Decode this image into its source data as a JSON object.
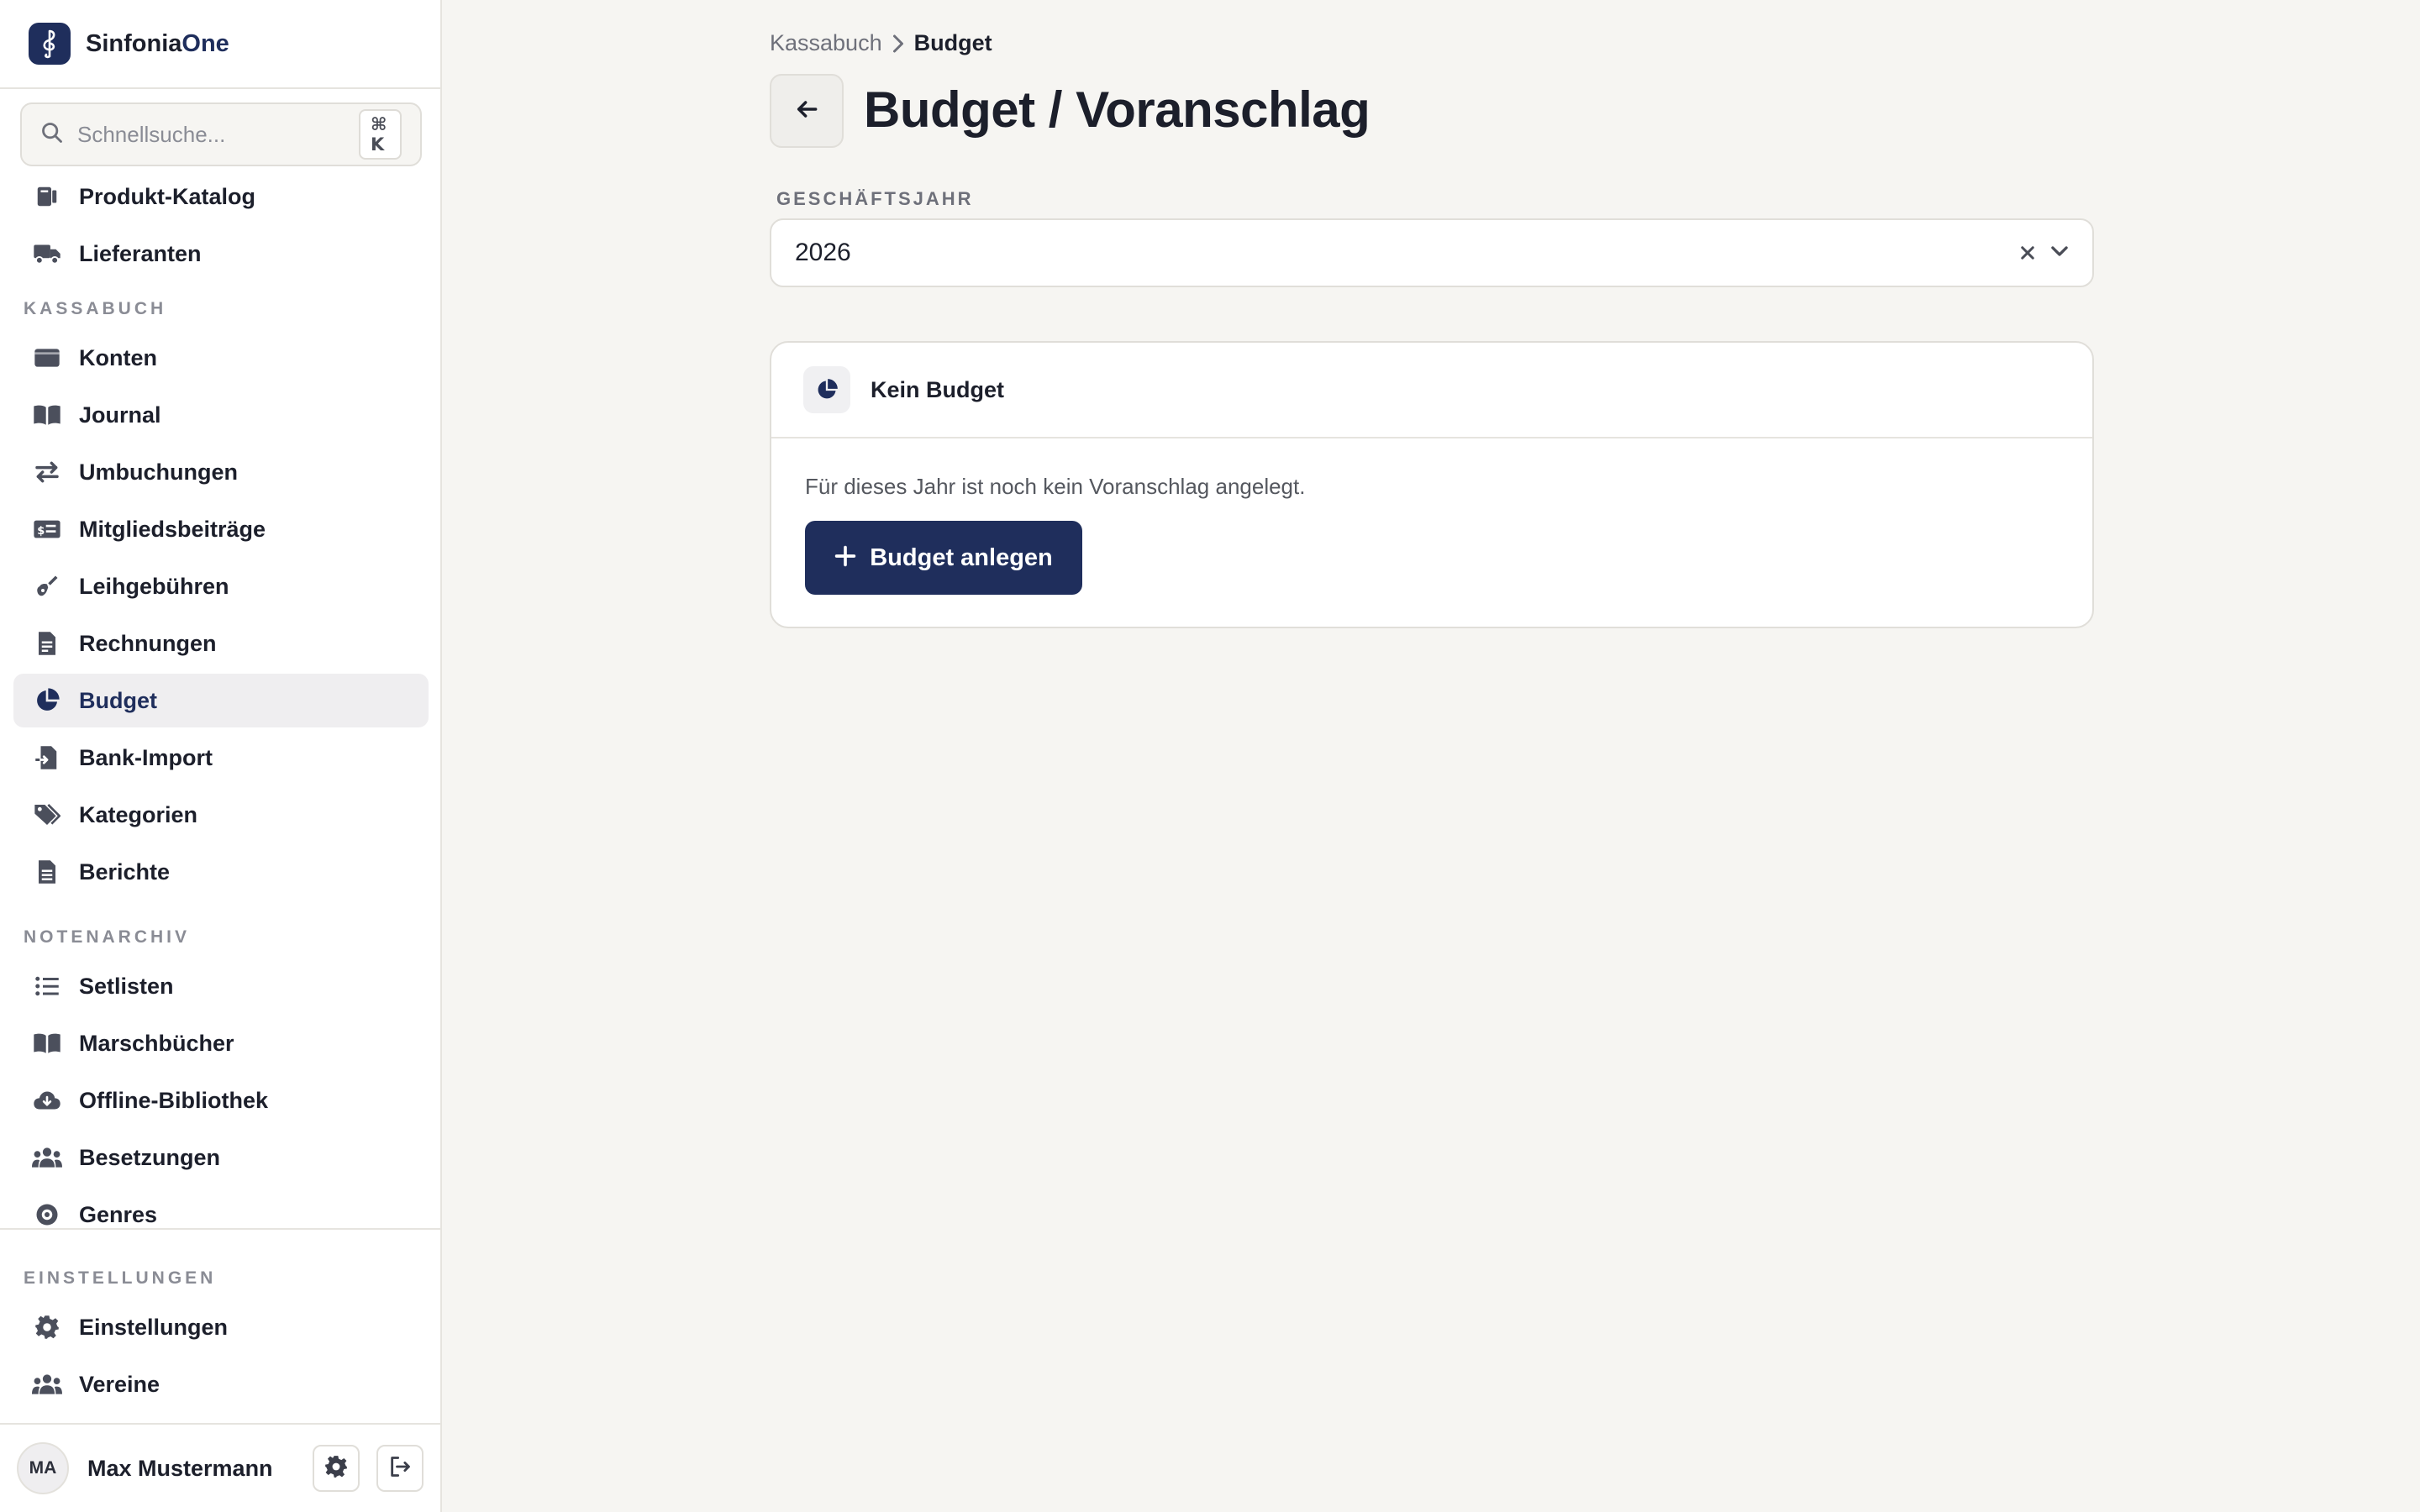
{
  "app": {
    "name_main": "Sinfonia",
    "name_accent": "One",
    "brand_color": "#1f2e5c"
  },
  "search": {
    "placeholder": "Schnellsuche...",
    "shortcut": "⌘ K"
  },
  "sidebar": {
    "top_items": [
      {
        "label": "Produkt-Katalog",
        "icon": "catalog-icon"
      },
      {
        "label": "Lieferanten",
        "icon": "truck-icon"
      }
    ],
    "sections": [
      {
        "title": "KASSABUCH",
        "items": [
          {
            "label": "Konten",
            "icon": "wallet-icon"
          },
          {
            "label": "Journal",
            "icon": "book-open-icon"
          },
          {
            "label": "Umbuchungen",
            "icon": "transfer-icon"
          },
          {
            "label": "Mitgliedsbeiträge",
            "icon": "money-card-icon"
          },
          {
            "label": "Leihgebühren",
            "icon": "guitar-icon"
          },
          {
            "label": "Rechnungen",
            "icon": "invoice-icon"
          },
          {
            "label": "Budget",
            "icon": "pie-chart-icon",
            "active": true
          },
          {
            "label": "Bank-Import",
            "icon": "file-import-icon"
          },
          {
            "label": "Kategorien",
            "icon": "tags-icon"
          },
          {
            "label": "Berichte",
            "icon": "report-icon"
          }
        ]
      },
      {
        "title": "NOTENARCHIV",
        "items": [
          {
            "label": "Setlisten",
            "icon": "list-icon"
          },
          {
            "label": "Marschbücher",
            "icon": "book-open-icon"
          },
          {
            "label": "Offline-Bibliothek",
            "icon": "cloud-download-icon"
          },
          {
            "label": "Besetzungen",
            "icon": "users-icon"
          },
          {
            "label": "Genres",
            "icon": "record-icon"
          }
        ]
      }
    ],
    "settings_section": {
      "title": "EINSTELLUNGEN",
      "items": [
        {
          "label": "Einstellungen",
          "icon": "gear-icon"
        },
        {
          "label": "Vereine",
          "icon": "users-icon"
        }
      ]
    }
  },
  "user": {
    "initials": "MA",
    "name": "Max Mustermann"
  },
  "breadcrumb": {
    "parent": "Kassabuch",
    "current": "Budget"
  },
  "page": {
    "title": "Budget / Voranschlag"
  },
  "fiscal_year": {
    "label": "GESCHÄFTSJAHR",
    "value": "2026"
  },
  "budget_card": {
    "title": "Kein Budget",
    "message": "Für dieses Jahr ist noch kein Voranschlag angelegt.",
    "button_label": "Budget anlegen"
  }
}
